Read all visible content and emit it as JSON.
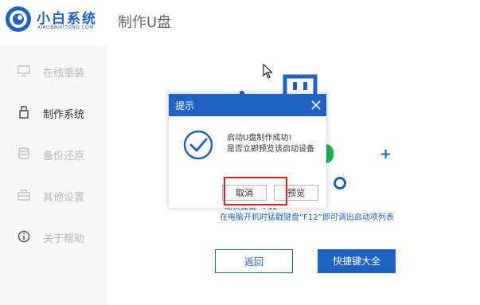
{
  "app": {
    "brand_name": "小白系统",
    "brand_sub": "XIAOBAIXITONG.COM",
    "page_title": "制作U盘",
    "accent_color": "#1f62c4"
  },
  "sidebar": {
    "items": [
      {
        "label": "在线重装",
        "icon": "monitor-icon",
        "active": false
      },
      {
        "label": "制作系统",
        "icon": "usb-drive-icon",
        "active": true
      },
      {
        "label": "备份还原",
        "icon": "database-icon",
        "active": false
      },
      {
        "label": "其他设置",
        "icon": "toolbox-icon",
        "active": false
      },
      {
        "label": "关于帮助",
        "icon": "info-icon",
        "active": false
      }
    ]
  },
  "main": {
    "hint_line1": "动快捷键” F12”",
    "hint_line2": "在电脑开机时猛戳键盘“F12”即可调出启动项列表",
    "back_label": "返回",
    "hotkeys_label": "快捷键大全"
  },
  "dialog": {
    "title": "提示",
    "message_line1": "启动U盘制作成功!",
    "message_line2": "是否立即预览该启动设备",
    "cancel_label": "取消",
    "preview_label": "预览",
    "success_color": "#1f62c4",
    "highlight_color": "#e02020"
  }
}
